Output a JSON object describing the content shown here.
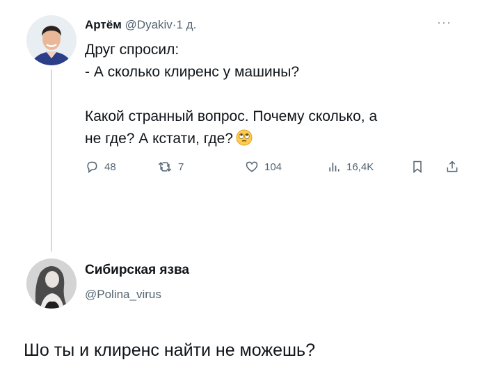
{
  "tweet": {
    "author_name": "Артём",
    "author_handle": "@Dyakiv",
    "separator": "·",
    "time": "1 д.",
    "more": "···",
    "text_lines": [
      "Друг спросил:",
      "- А сколько клиренс у машины?",
      "Какой странный вопрос. Почему сколько, а",
      "не где? А кстати, где?"
    ],
    "emoji": "face-with-rolling-eyes",
    "actions": {
      "replies": "48",
      "retweets": "7",
      "likes": "104",
      "views": "16,4K"
    }
  },
  "reply": {
    "author_name": "Сибирская язва",
    "author_handle": "@Polina_virus",
    "text": "Шо ты и клиренс найти не можешь?"
  },
  "colors": {
    "text": "#0f1419",
    "secondary": "#536471",
    "thread_line": "#cfd9de",
    "avatar_shirt": "#2b3e8a"
  }
}
